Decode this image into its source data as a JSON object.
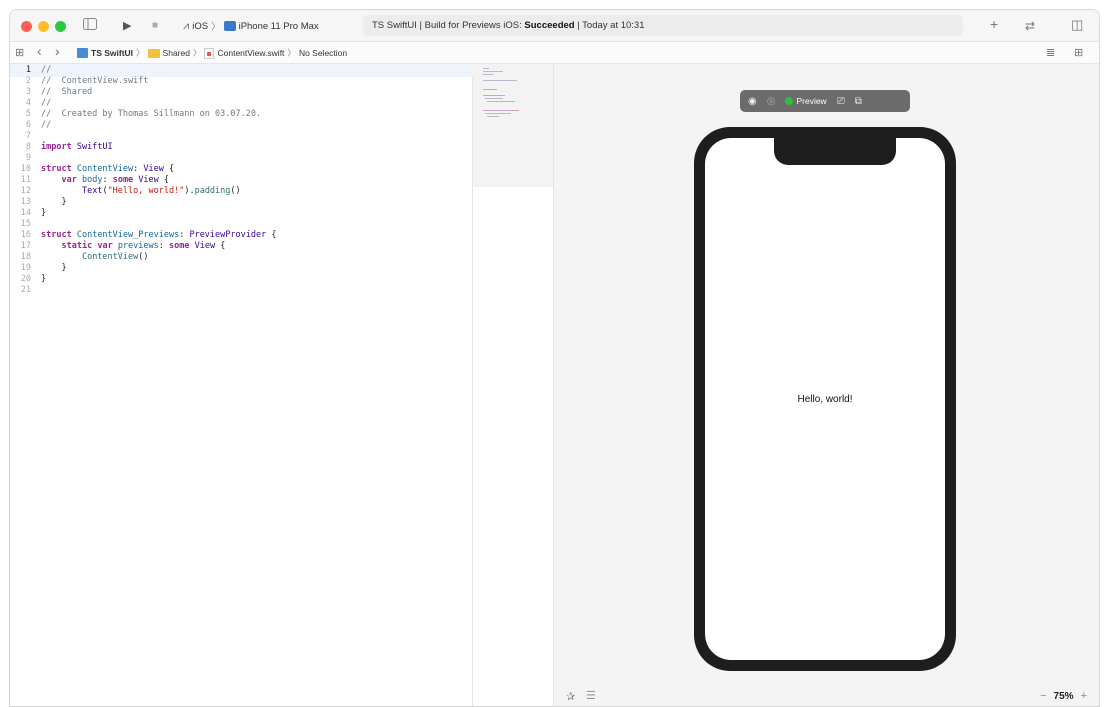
{
  "toolbar": {
    "navigator_icon": "sidebar-icon",
    "run_icon": "▶",
    "stop_icon": "■",
    "platform": "iOS",
    "device": "iPhone 11 Pro Max",
    "status_project": "TS SwiftUI",
    "status_sep1": "|",
    "status_action": "Build for Previews iOS:",
    "status_result": "Succeeded",
    "status_sep2": "|",
    "status_time": "Today at 10:31",
    "add_icon": "+",
    "swap_icon": "⇄",
    "inspector_icon": "◫"
  },
  "jumpbar": {
    "grid_icon": "⊞",
    "back_icon": "‹",
    "forward_icon": "›",
    "project": "TS SwiftUI",
    "folder": "Shared",
    "file": "ContentView.swift",
    "selection": "No Selection",
    "canvas_toggle_icon": "≣",
    "add_editor_icon": "⊞"
  },
  "editor": {
    "lines": [
      {
        "n": "1",
        "t": "//"
      },
      {
        "n": "2",
        "t": "//  ContentView.swift"
      },
      {
        "n": "3",
        "t": "//  Shared"
      },
      {
        "n": "4",
        "t": "//"
      },
      {
        "n": "5",
        "t": "//  Created by Thomas Sillmann on 03.07.20."
      },
      {
        "n": "6",
        "t": "//"
      },
      {
        "n": "7",
        "t": ""
      },
      {
        "n": "8",
        "t": "import SwiftUI"
      },
      {
        "n": "9",
        "t": ""
      },
      {
        "n": "10",
        "t": "struct ContentView: View {"
      },
      {
        "n": "11",
        "t": "    var body: some View {"
      },
      {
        "n": "12",
        "t": "        Text(\"Hello, world!\").padding()"
      },
      {
        "n": "13",
        "t": "    }"
      },
      {
        "n": "14",
        "t": "}"
      },
      {
        "n": "15",
        "t": ""
      },
      {
        "n": "16",
        "t": "struct ContentView_Previews: PreviewProvider {"
      },
      {
        "n": "17",
        "t": "    static var previews: some View {"
      },
      {
        "n": "18",
        "t": "        ContentView()"
      },
      {
        "n": "19",
        "t": "    }"
      },
      {
        "n": "20",
        "t": "}"
      },
      {
        "n": "21",
        "t": ""
      }
    ]
  },
  "canvas": {
    "live_icon": "◉",
    "inspect_icon": "◎",
    "preview_label": "Preview",
    "device_settings_icon": "⎚",
    "duplicate_icon": "⧉",
    "hello_text": "Hello, world!",
    "pin_icon": "✰",
    "list_icon": "☰",
    "zoom_out_icon": "−",
    "zoom_level": "75%",
    "zoom_in_icon": "+"
  }
}
